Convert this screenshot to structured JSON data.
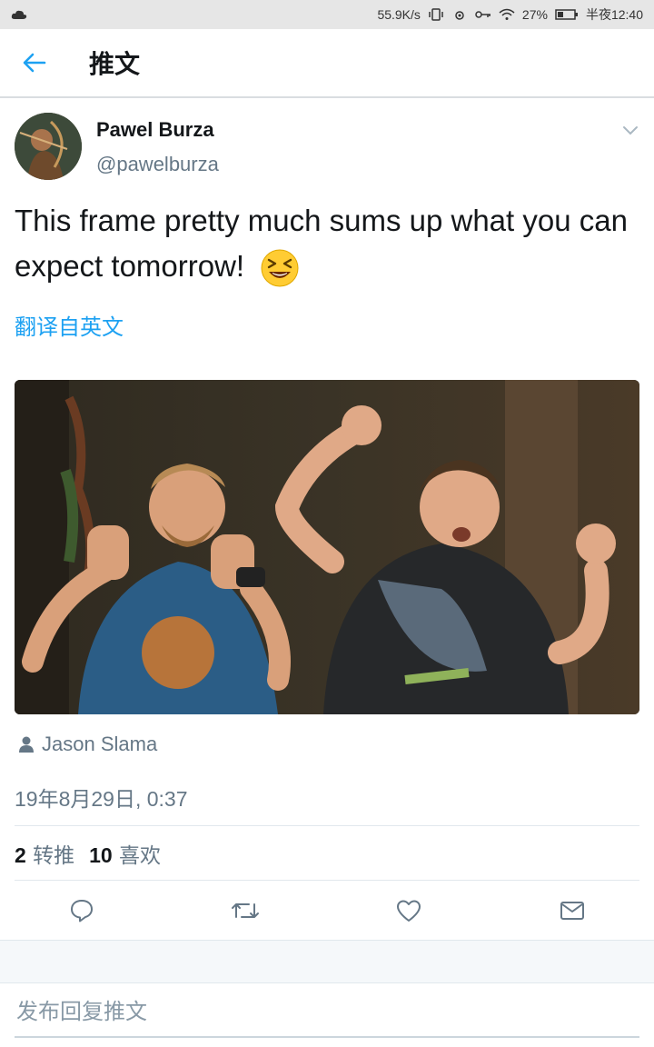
{
  "status_bar": {
    "network_speed": "55.9K/s",
    "battery": "27%",
    "time": "半夜12:40"
  },
  "header": {
    "title": "推文"
  },
  "tweet": {
    "author_name": "Pawel Burza",
    "author_handle": "@pawelburza",
    "text": "This frame pretty much sums up what you can expect tomorrow!",
    "translate_label": "翻译自英文",
    "tagged_user": "Jason Slama",
    "timestamp": "19年8月29日, 0:37",
    "retweets_count": "2",
    "retweets_label": "转推",
    "likes_count": "10",
    "likes_label": "喜欢"
  },
  "reply": {
    "placeholder": "发布回复推文"
  },
  "colors": {
    "accent": "#1da1f2",
    "secondary_text": "#657786",
    "divider": "#e1e8ed"
  }
}
